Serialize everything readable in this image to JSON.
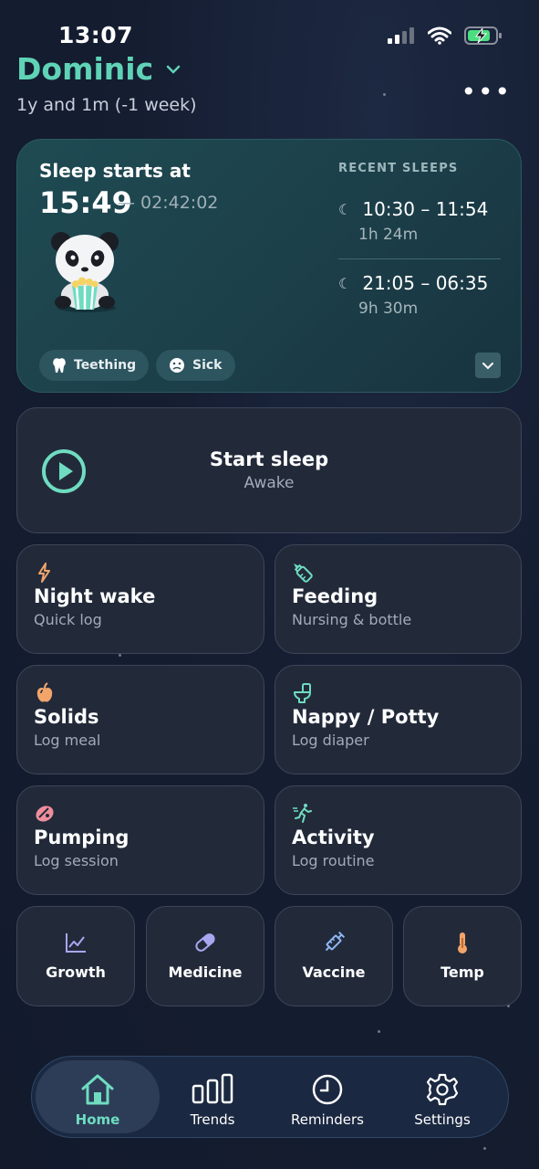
{
  "status_bar": {
    "time": "13:07"
  },
  "header": {
    "child_name": "Dominic",
    "child_age": "1y and 1m (-1 week)"
  },
  "sleep_card": {
    "label": "Sleep starts at",
    "start_time": "15:49",
    "elapsed": "— 02:42:02",
    "recent_title": "RECENT SLEEPS",
    "recent": [
      {
        "range": "10:30 – 11:54",
        "duration": "1h 24m"
      },
      {
        "range": "21:05 – 06:35",
        "duration": "9h 30m"
      }
    ],
    "tags": [
      "Teething",
      "Sick"
    ]
  },
  "start_sleep": {
    "title": "Start sleep",
    "subtitle": "Awake"
  },
  "tiles": [
    {
      "title": "Night wake",
      "subtitle": "Quick log",
      "icon": "bolt-icon"
    },
    {
      "title": "Feeding",
      "subtitle": "Nursing & bottle",
      "icon": "bottle-icon"
    },
    {
      "title": "Solids",
      "subtitle": "Log meal",
      "icon": "apple-icon"
    },
    {
      "title": "Nappy / Potty",
      "subtitle": "Log diaper",
      "icon": "toilet-icon"
    },
    {
      "title": "Pumping",
      "subtitle": "Log session",
      "icon": "pump-icon"
    },
    {
      "title": "Activity",
      "subtitle": "Log routine",
      "icon": "running-icon"
    }
  ],
  "small_tiles": [
    {
      "label": "Growth",
      "icon": "growth-chart-icon"
    },
    {
      "label": "Medicine",
      "icon": "pill-icon"
    },
    {
      "label": "Vaccine",
      "icon": "syringe-icon"
    },
    {
      "label": "Temp",
      "icon": "thermometer-icon"
    }
  ],
  "nav": [
    {
      "label": "Home",
      "icon": "home-icon",
      "active": true
    },
    {
      "label": "Trends",
      "icon": "bars-icon"
    },
    {
      "label": "Reminders",
      "icon": "clock-icon"
    },
    {
      "label": "Settings",
      "icon": "gear-icon"
    }
  ],
  "colors": {
    "accent": "#5fd3b6",
    "card_bg": "#1f4b53",
    "tile_bg": "#222a3a",
    "background": "#151d31"
  }
}
